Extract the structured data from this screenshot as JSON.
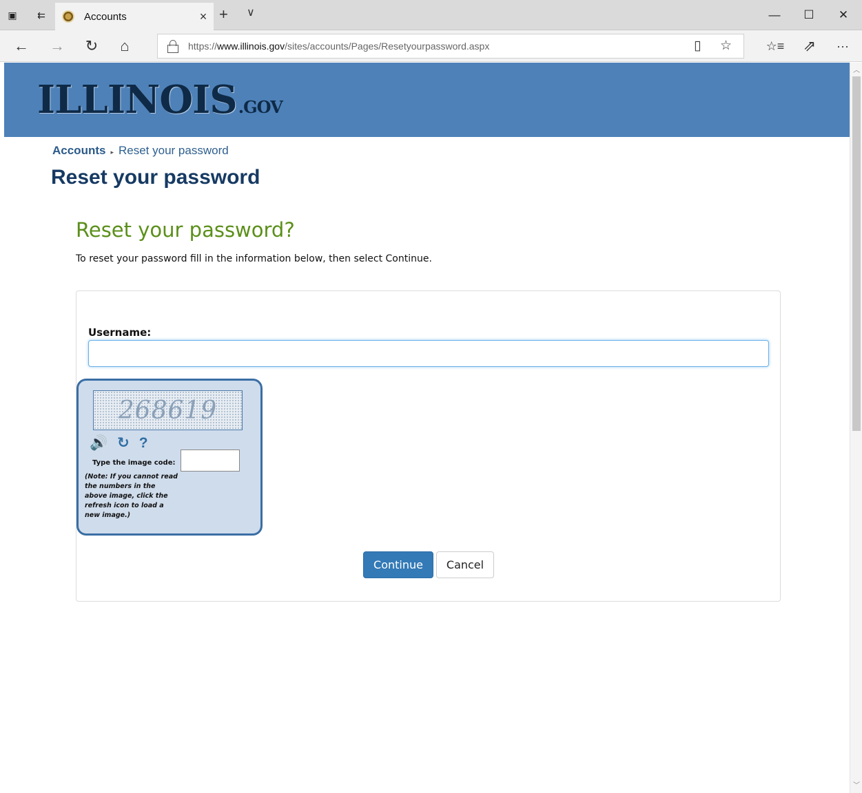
{
  "browser": {
    "tab_title": "Accounts",
    "tab_close": "×",
    "new_tab": "+",
    "tab_menu": "∨",
    "url_prefix": "https://",
    "url_host": "www.illinois.gov",
    "url_path": "/sites/accounts/Pages/Resetyourpassword.aspx",
    "window_controls": {
      "minimize": "—",
      "maximize": "☐",
      "close": "✕"
    },
    "nav": {
      "back": "←",
      "forward": "→",
      "refresh": "↻",
      "home": "⌂",
      "reading_view": "▯",
      "favorite": "☆",
      "favorites_hub": "☆≡",
      "share": "⇗",
      "more": "···"
    },
    "titlebar_icons": {
      "tabs_aside": "▣",
      "restore_tabs": "⇇"
    }
  },
  "header": {
    "logo_main": "ILLINOIS",
    "logo_suffix": ".GOV"
  },
  "breadcrumb": {
    "root": "Accounts",
    "separator": "▸",
    "current": "Reset your password"
  },
  "page_title": "Reset your password",
  "form": {
    "heading": "Reset your password?",
    "intro": "To reset your password fill in the information below, then select Continue.",
    "username_label": "Username:",
    "username_value": "",
    "captcha": {
      "code": "268619",
      "audio_icon": "🔊",
      "refresh_icon": "↻",
      "help_icon": "?",
      "label": "Type the image code:",
      "value": "",
      "note": "(Note: If you cannot read the numbers in the above image, click the refresh icon to load a new image.)"
    },
    "continue_label": "Continue",
    "cancel_label": "Cancel"
  },
  "colors": {
    "banner": "#4e81b8",
    "page_title": "#163a63",
    "form_heading": "#5b8f1a",
    "primary_button": "#337ab7",
    "captcha_border": "#3a6ea4"
  }
}
